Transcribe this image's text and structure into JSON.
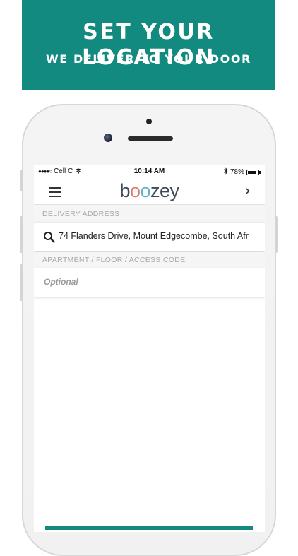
{
  "banner": {
    "title": "SET YOUR LOCATION",
    "subtitle": "WE DELIVER TO YOUR DOOR",
    "color": "#138a80"
  },
  "status": {
    "signal": "●●●●○",
    "carrier": "Cell C",
    "wifi_icon": "wifi-icon",
    "time": "10:14 AM",
    "bluetooth_icon": "bluetooth-icon",
    "battery_percent": "78%",
    "battery_level": 0.78
  },
  "nav": {
    "menu_icon": "hamburger-menu-icon",
    "logo_b": "b",
    "logo_o1": "o",
    "logo_o2": "o",
    "logo_rest": "zey",
    "next_icon": "chevron-right-icon",
    "next_glyph": "›"
  },
  "form": {
    "delivery_label": "DELIVERY ADDRESS",
    "address_value": "74 Flanders Drive, Mount Edgecombe, South Afr",
    "search_icon": "search-icon",
    "apartment_label": "APARTMENT / FLOOR / ACCESS CODE",
    "apartment_placeholder": "Optional"
  }
}
